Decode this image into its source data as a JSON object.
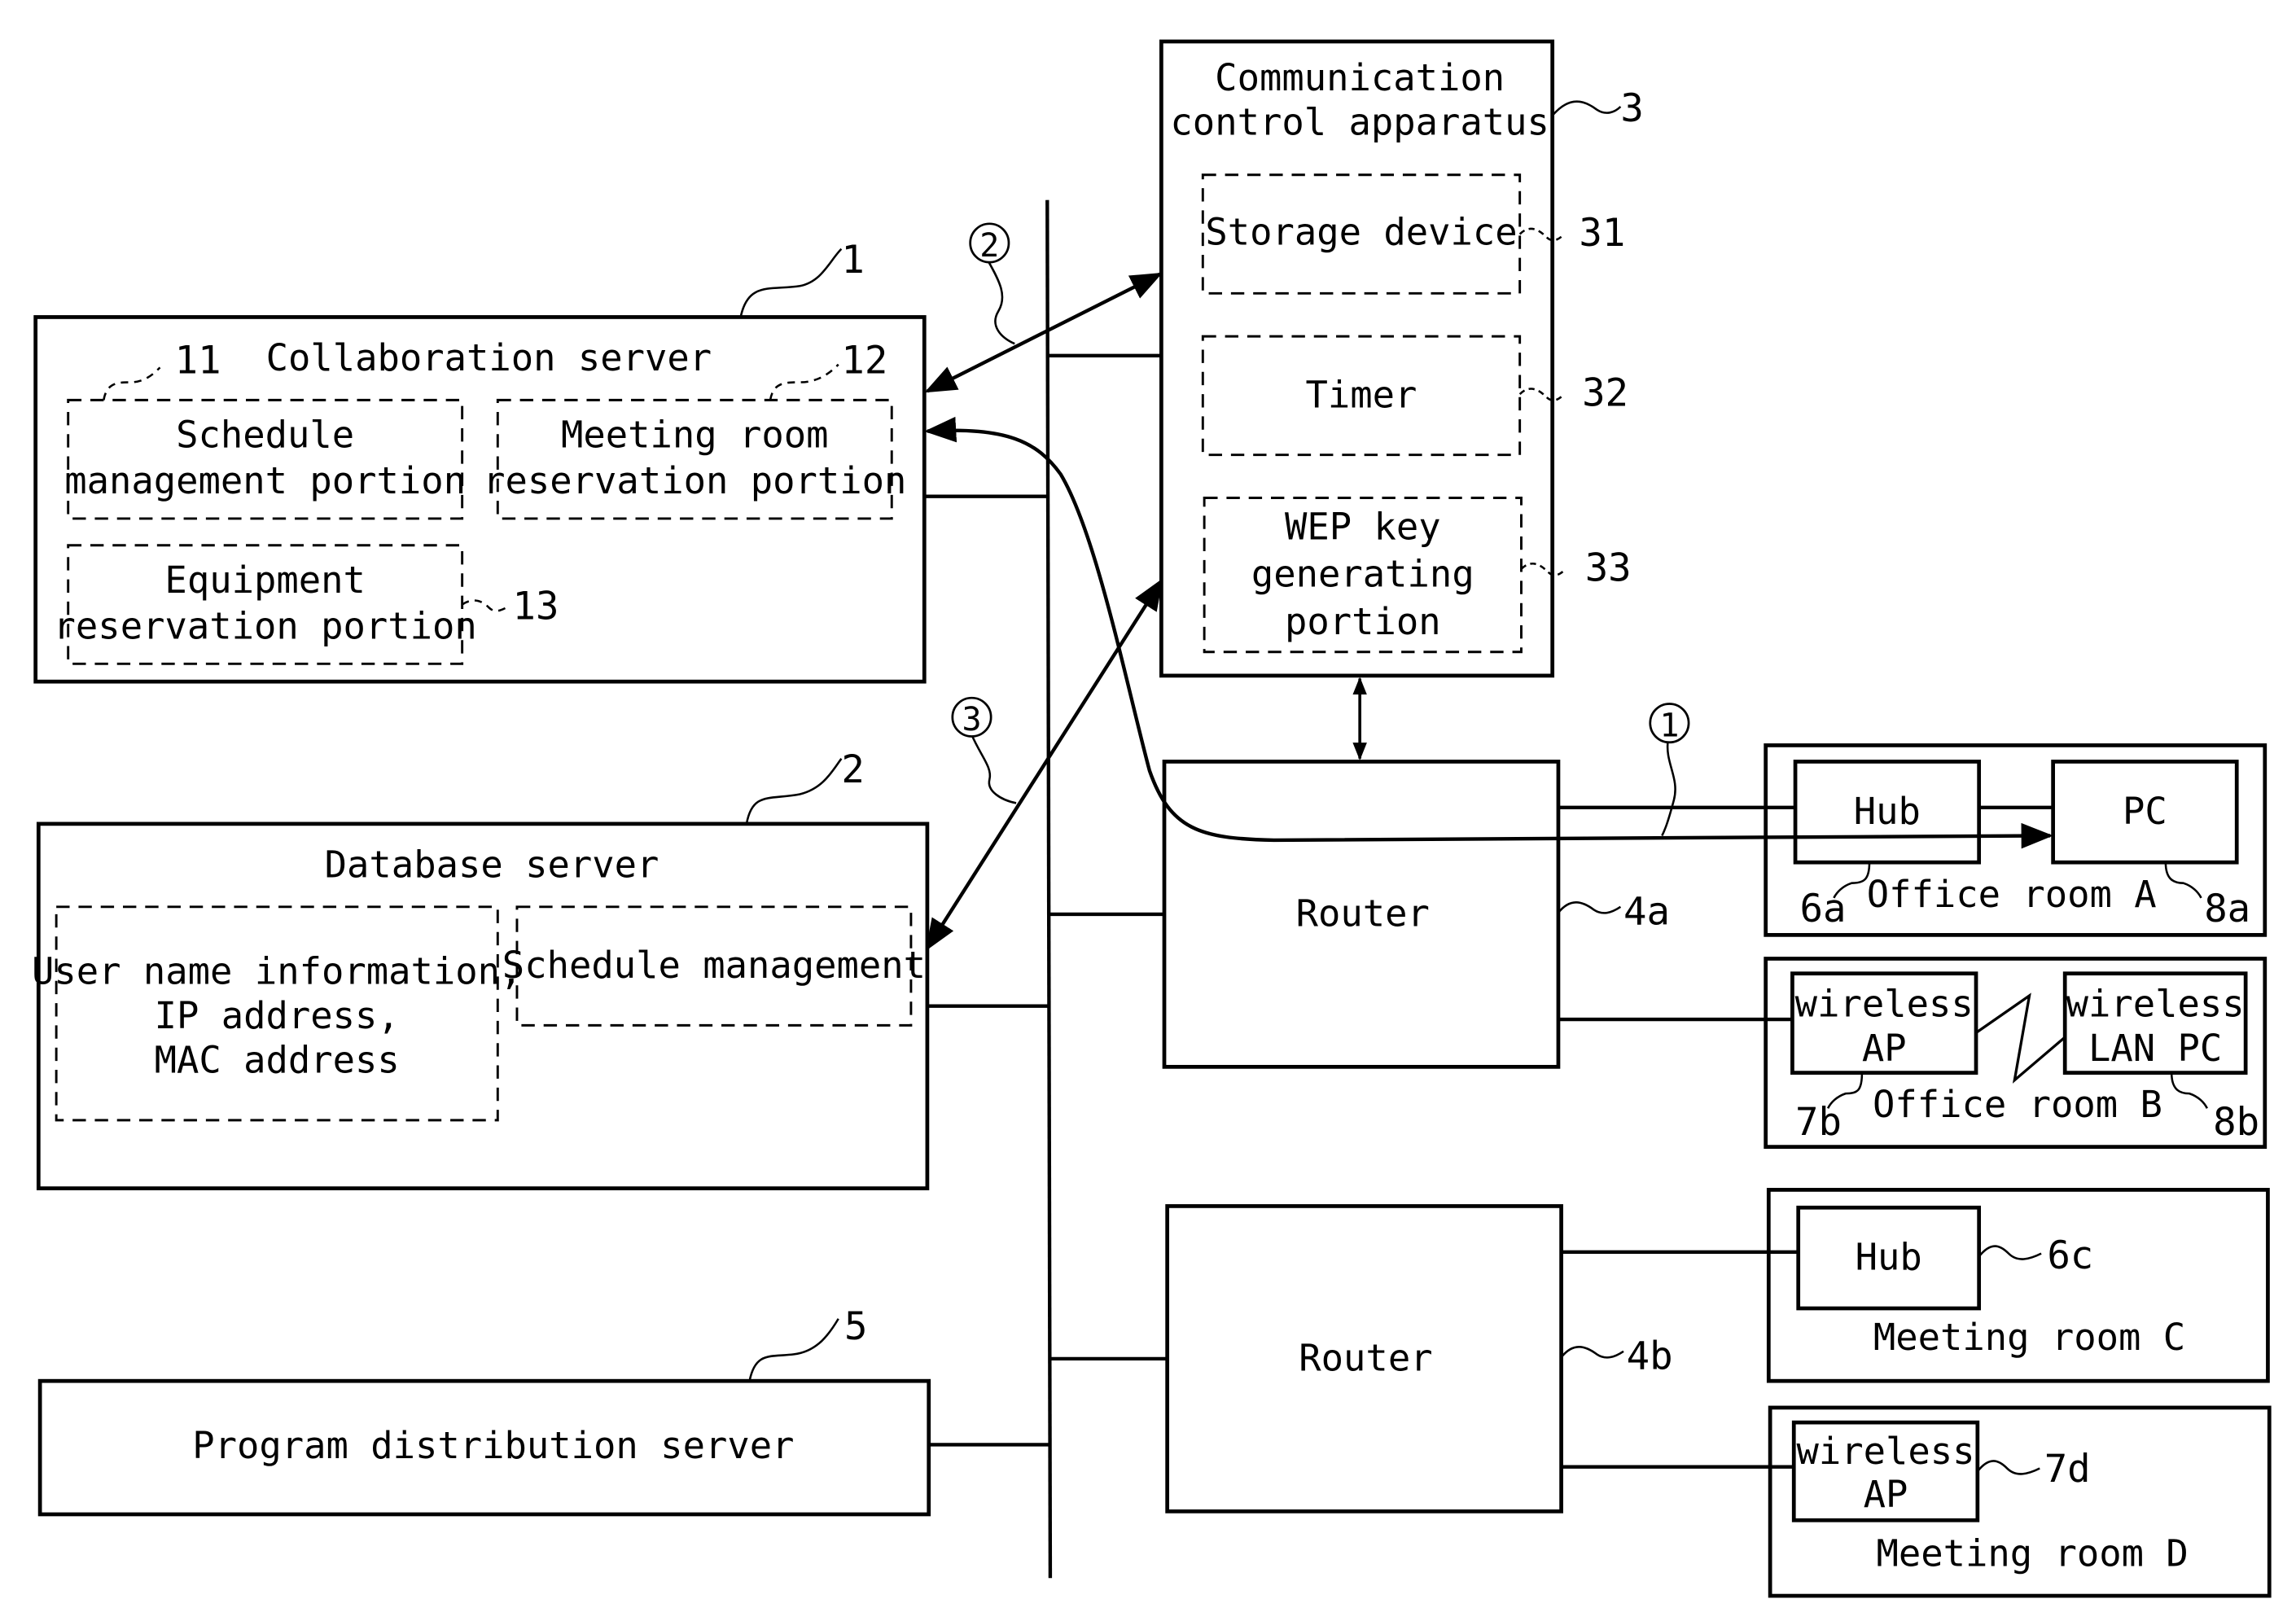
{
  "figure": {
    "components": {
      "collaboration_server": {
        "ref": "1",
        "title": "Collaboration server",
        "parts": [
          {
            "ref": "11",
            "lines": [
              "Schedule",
              "management portion"
            ]
          },
          {
            "ref": "12",
            "lines": [
              "Meeting room",
              "reservation portion"
            ]
          },
          {
            "ref": "13",
            "lines": [
              "Equipment",
              "reservation portion"
            ]
          }
        ]
      },
      "database_server": {
        "ref": "2",
        "title": "Database server",
        "parts": [
          {
            "lines": [
              "User name information,",
              "IP address,",
              "MAC address"
            ]
          },
          {
            "lines": [
              "Schedule management"
            ]
          }
        ]
      },
      "communication_control_apparatus": {
        "ref": "3",
        "title_lines": [
          "Communication",
          "control apparatus"
        ],
        "parts": [
          {
            "ref": "31",
            "lines": [
              "Storage device"
            ]
          },
          {
            "ref": "32",
            "lines": [
              "Timer"
            ]
          },
          {
            "ref": "33",
            "lines": [
              "WEP key",
              "generating",
              "portion"
            ]
          }
        ]
      },
      "router_a": {
        "ref": "4a",
        "title": "Router"
      },
      "router_b": {
        "ref": "4b",
        "title": "Router"
      },
      "program_distribution_server": {
        "ref": "5",
        "title": "Program distribution server"
      }
    },
    "rooms": [
      {
        "name": "Office room A",
        "devices": [
          {
            "ref": "6a",
            "lines": [
              "Hub"
            ]
          },
          {
            "ref": "8a",
            "lines": [
              "PC"
            ]
          }
        ]
      },
      {
        "name": "Office room B",
        "devices": [
          {
            "ref": "7b",
            "lines": [
              "wireless",
              "AP"
            ]
          },
          {
            "ref": "8b",
            "lines": [
              "wireless",
              "LAN PC"
            ]
          }
        ]
      },
      {
        "name": "Meeting room C",
        "devices": [
          {
            "ref": "6c",
            "lines": [
              "Hub"
            ]
          }
        ]
      },
      {
        "name": "Meeting room D",
        "devices": [
          {
            "ref": "7d",
            "lines": [
              "wireless",
              "AP"
            ]
          }
        ]
      }
    ],
    "flow_markers": [
      "①",
      "②",
      "③"
    ]
  }
}
